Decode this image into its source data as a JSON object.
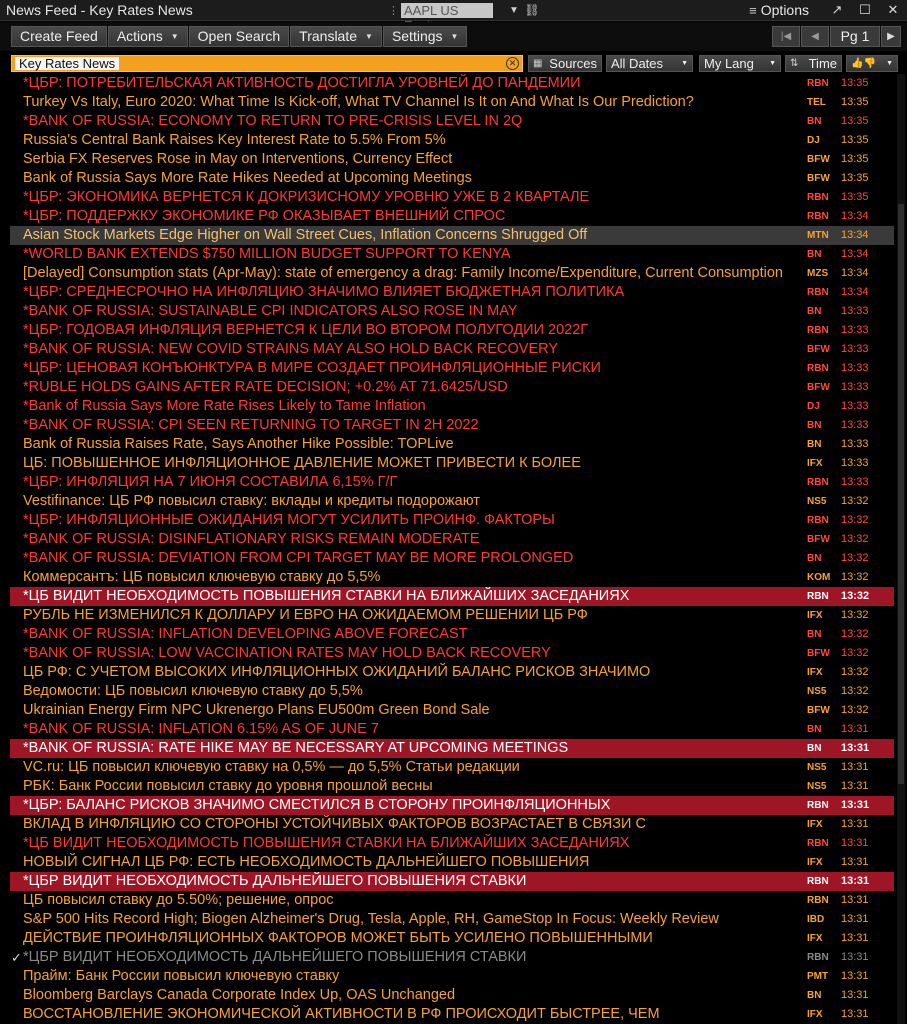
{
  "window": {
    "title": "News Feed - Key Rates News",
    "ticker": "AAPL US Equity",
    "options_label": "Options"
  },
  "toolbar": {
    "create_feed": "Create Feed",
    "actions": "Actions",
    "open_search": "Open Search",
    "translate": "Translate",
    "settings": "Settings",
    "page": "Pg 1"
  },
  "filters": {
    "search_tag": "Key Rates News",
    "sources": "Sources",
    "dates": "All Dates",
    "language": "My Lang",
    "sort": "Time"
  },
  "colors": {
    "red": "#ff3a34",
    "orange": "#f7a237",
    "highlight_red": "#9e1626",
    "search_orange": "#f3a01f"
  },
  "stories": [
    {
      "headline": "*ЦБР: ПОТРЕБИТЕЛЬСКАЯ АКТИВНОСТЬ ДОСТИГЛА УРОВНЕЙ ДО ПАНДЕМИИ",
      "source": "RBN",
      "time": "13:35",
      "style": "red"
    },
    {
      "headline": "Turkey Vs Italy, Euro 2020: What Time Is Kick-off, What TV Channel Is It on And What Is Our Prediction?",
      "source": "TEL",
      "time": "13:35",
      "style": "orange"
    },
    {
      "headline": "*BANK OF RUSSIA: ECONOMY TO RETURN TO PRE-CRISIS LEVEL IN 2Q",
      "source": "BN",
      "time": "13:35",
      "style": "red"
    },
    {
      "headline": "Russia's Central Bank Raises Key Interest Rate to 5.5% From 5%",
      "source": "DJ",
      "time": "13:35",
      "style": "orange"
    },
    {
      "headline": "Serbia FX Reserves Rose in May on Interventions, Currency Effect",
      "source": "BFW",
      "time": "13:35",
      "style": "orange"
    },
    {
      "headline": "Bank of Russia Says More Rate Hikes Needed at Upcoming Meetings",
      "source": "BFW",
      "time": "13:35",
      "style": "orange"
    },
    {
      "headline": "*ЦБР: ЭКОНОМИКА ВЕРНЕТСЯ К ДОКРИЗИСНОМУ УРОВНЮ УЖЕ В 2 КВАРТАЛЕ",
      "source": "RBN",
      "time": "13:35",
      "style": "red"
    },
    {
      "headline": "*ЦБР: ПОДДЕРЖКУ ЭКОНОМИКЕ РФ ОКАЗЫВАЕТ ВНЕШНИЙ СПРОС",
      "source": "RBN",
      "time": "13:34",
      "style": "red"
    },
    {
      "headline": "Asian Stock Markets Edge Higher on Wall Street Cues, Inflation Concerns Shrugged Off",
      "source": "MTN",
      "time": "13:34",
      "style": "hl-gray"
    },
    {
      "headline": "*WORLD BANK EXTENDS $750 MILLION BUDGET SUPPORT TO KENYA",
      "source": "BN",
      "time": "13:34",
      "style": "red"
    },
    {
      "headline": "[Delayed] Consumption stats (Apr-May): state of emergency a drag: Family Income/Expenditure, Current Consumption",
      "source": "MZS",
      "time": "13:34",
      "style": "orange"
    },
    {
      "headline": "*ЦБР: СРЕДНЕСРОЧНО НА ИНФЛЯЦИЮ ЗНАЧИМО ВЛИЯЕТ БЮДЖЕТНАЯ ПОЛИТИКА",
      "source": "RBN",
      "time": "13:34",
      "style": "red"
    },
    {
      "headline": "*BANK OF RUSSIA: SUSTAINABLE CPI INDICATORS ALSO ROSE IN MAY",
      "source": "BN",
      "time": "13:33",
      "style": "red"
    },
    {
      "headline": "*ЦБР: ГОДОВАЯ ИНФЛЯЦИЯ ВЕРНЕТСЯ К ЦЕЛИ ВО ВТОРОМ ПОЛУГОДИИ 2022Г",
      "source": "RBN",
      "time": "13:33",
      "style": "red"
    },
    {
      "headline": "*BANK OF RUSSIA: NEW COVID STRAINS MAY ALSO HOLD BACK RECOVERY",
      "source": "BFW",
      "time": "13:33",
      "style": "red"
    },
    {
      "headline": "*ЦБР: ЦЕНОВАЯ КОНЪЮНКТУРА В МИРЕ СОЗДАЕТ ПРОИНФЛЯЦИОННЫЕ РИСКИ",
      "source": "RBN",
      "time": "13:33",
      "style": "red"
    },
    {
      "headline": "*RUBLE HOLDS GAINS AFTER RATE DECISION; +0.2% AT 71.6425/USD",
      "source": "BFW",
      "time": "13:33",
      "style": "red"
    },
    {
      "headline": "*Bank of Russia Says More Rate Rises Likely to Tame Inflation",
      "source": "DJ",
      "time": "13:33",
      "style": "red"
    },
    {
      "headline": "*BANK OF RUSSIA: CPI SEEN RETURNING TO TARGET IN 2H 2022",
      "source": "BN",
      "time": "13:33",
      "style": "red"
    },
    {
      "headline": "Bank of Russia Raises Rate, Says Another Hike Possible: TOPLive",
      "source": "BN",
      "time": "13:33",
      "style": "orange"
    },
    {
      "headline": "ЦБ: ПОВЫШЕННОЕ ИНФЛЯЦИОННОЕ ДАВЛЕНИЕ МОЖЕТ ПРИВЕСТИ К БОЛЕЕ",
      "source": "IFX",
      "time": "13:33",
      "style": "orange"
    },
    {
      "headline": "*ЦБР: ИНФЛЯЦИЯ НА 7 ИЮНЯ СОСТАВИЛА 6,15% Г/Г",
      "source": "RBN",
      "time": "13:33",
      "style": "red"
    },
    {
      "headline": "Vestifinance: ЦБ РФ повысил ставку: вклады и кредиты подорожают",
      "source": "NS5",
      "time": "13:32",
      "style": "orange"
    },
    {
      "headline": "*ЦБР: ИНФЛЯЦИОННЫЕ ОЖИДАНИЯ МОГУТ УСИЛИТЬ ПРОИНФ. ФАКТОРЫ",
      "source": "RBN",
      "time": "13:32",
      "style": "red"
    },
    {
      "headline": "*BANK OF RUSSIA: DISINFLATIONARY RISKS REMAIN MODERATE",
      "source": "BFW",
      "time": "13:32",
      "style": "red"
    },
    {
      "headline": "*BANK OF RUSSIA: DEVIATION FROM CPI TARGET MAY BE MORE PROLONGED",
      "source": "BN",
      "time": "13:32",
      "style": "red"
    },
    {
      "headline": "Коммерсантъ: ЦБ повысил ключевую ставку до 5,5%",
      "source": "KOM",
      "time": "13:32",
      "style": "orange"
    },
    {
      "headline": "*ЦБ ВИДИТ НЕОБХОДИМОСТЬ ПОВЫШЕНИЯ СТАВКИ НА БЛИЖАЙШИХ ЗАСЕДАНИЯХ",
      "source": "RBN",
      "time": "13:32",
      "style": "hl-red"
    },
    {
      "headline": "РУБЛЬ НЕ ИЗМЕНИЛСЯ К ДОЛЛАРУ И ЕВРО НА ОЖИДАЕМОМ РЕШЕНИИ ЦБ РФ",
      "source": "IFX",
      "time": "13:32",
      "style": "orange"
    },
    {
      "headline": "*BANK OF RUSSIA: INFLATION DEVELOPING ABOVE FORECAST",
      "source": "BN",
      "time": "13:32",
      "style": "red"
    },
    {
      "headline": "*BANK OF RUSSIA: LOW VACCINATION RATES MAY HOLD BACK RECOVERY",
      "source": "BFW",
      "time": "13:32",
      "style": "red"
    },
    {
      "headline": "ЦБ РФ: С УЧЕТОМ ВЫСОКИХ ИНФЛЯЦИОННЫХ ОЖИДАНИЙ БАЛАНС РИСКОВ ЗНАЧИМО",
      "source": "IFX",
      "time": "13:32",
      "style": "orange"
    },
    {
      "headline": "Ведомости: ЦБ повысил ключевую ставку до 5,5%",
      "source": "NS5",
      "time": "13:32",
      "style": "orange"
    },
    {
      "headline": "Ukrainian Energy Firm NPC Ukrenergo Plans EU500m Green Bond Sale",
      "source": "BFW",
      "time": "13:32",
      "style": "orange"
    },
    {
      "headline": "*BANK OF RUSSIA: INFLATION 6.15% AS OF JUNE 7",
      "source": "BN",
      "time": "13:31",
      "style": "red"
    },
    {
      "headline": "*BANK OF RUSSIA: RATE HIKE MAY BE NECESSARY AT UPCOMING MEETINGS",
      "source": "BN",
      "time": "13:31",
      "style": "hl-red"
    },
    {
      "headline": "VC.ru: ЦБ повысил ключевую ставку на 0,5% — до 5,5% Статьи редакции",
      "source": "NS5",
      "time": "13:31",
      "style": "orange"
    },
    {
      "headline": "РБК: Банк России повысил ставку до уровня прошлой весны",
      "source": "NS5",
      "time": "13:31",
      "style": "orange"
    },
    {
      "headline": "*ЦБР: БАЛАНС РИСКОВ ЗНАЧИМО СМЕСТИЛСЯ В СТОРОНУ ПРОИНФЛЯЦИОННЫХ",
      "source": "RBN",
      "time": "13:31",
      "style": "hl-red"
    },
    {
      "headline": "ВКЛАД В ИНФЛЯЦИЮ СО СТОРОНЫ УСТОЙЧИВЫХ ФАКТОРОВ ВОЗРАСТАЕТ В СВЯЗИ С",
      "source": "IFX",
      "time": "13:31",
      "style": "orange"
    },
    {
      "headline": "*ЦБ ВИДИТ НЕОБХОДИМОСТЬ ПОВЫШЕНИЯ СТАВКИ НА БЛИЖАЙШИХ ЗАСЕДАНИЯХ",
      "source": "RBN",
      "time": "13:31",
      "style": "red"
    },
    {
      "headline": "НОВЫЙ СИГНАЛ ЦБ РФ: ЕСТЬ НЕОБХОДИМОСТЬ ДАЛЬНЕЙШЕГО ПОВЫШЕНИЯ",
      "source": "IFX",
      "time": "13:31",
      "style": "orange"
    },
    {
      "headline": "*ЦБР ВИДИТ НЕОБХОДИМОСТЬ ДАЛЬНЕЙШЕГО ПОВЫШЕНИЯ СТАВКИ",
      "source": "RBN",
      "time": "13:31",
      "style": "hl-red"
    },
    {
      "headline": "ЦБ повысил ставку до 5.50%; решение, опрос",
      "source": "RBN",
      "time": "13:31",
      "style": "orange"
    },
    {
      "headline": "S&P 500 Hits Record High; Biogen Alzheimer's Drug, Tesla, Apple, RH, GameStop In Focus: Weekly Review",
      "source": "IBD",
      "time": "13:31",
      "style": "orange"
    },
    {
      "headline": "ДЕЙСТВИЕ ПРОИНФЛЯЦИОННЫХ ФАКТОРОВ МОЖЕТ БЫТЬ УСИЛЕНО ПОВЫШЕННЫМИ",
      "source": "IFX",
      "time": "13:31",
      "style": "orange"
    },
    {
      "headline": "*ЦБР ВИДИТ НЕОБХОДИМОСТЬ ДАЛЬНЕЙШЕГО ПОВЫШЕНИЯ СТАВКИ",
      "source": "RBN",
      "time": "13:31",
      "style": "gray",
      "checked": true
    },
    {
      "headline": "Прайм: Банк России повысил ключевую ставку",
      "source": "PMT",
      "time": "13:31",
      "style": "orange"
    },
    {
      "headline": "Bloomberg Barclays Canada Corporate Index Up, OAS Unchanged",
      "source": "BN",
      "time": "13:31",
      "style": "orange"
    },
    {
      "headline": "ВОССТАНОВЛЕНИЕ ЭКОНОМИЧЕСКОЙ АКТИВНОСТИ В РФ ПРОИСХОДИТ БЫСТРЕЕ, ЧЕМ",
      "source": "IFX",
      "time": "13:31",
      "style": "orange"
    }
  ]
}
